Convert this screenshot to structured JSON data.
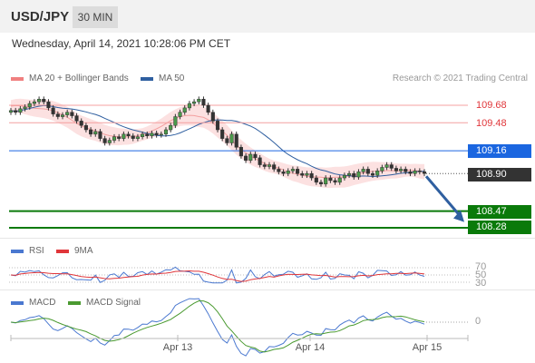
{
  "header": {
    "symbol": "USD/JPY",
    "timeframe": "30 MIN"
  },
  "datetime": "Wednesday, April 14, 2021 10:28:06 PM CET",
  "legend": {
    "items": [
      {
        "label": "MA 20 + Bollinger Bands",
        "color": "#f08080"
      },
      {
        "label": "MA 50",
        "color": "#2f5fa0"
      }
    ],
    "credit": "Research © 2021 Trading Central"
  },
  "chart_data": {
    "type": "candlestick",
    "symbol": "USD/JPY",
    "timeframe": "30 MIN",
    "x_ticks": [
      "Apr 13",
      "Apr 14",
      "Apr 15"
    ],
    "price_range": [
      108.2,
      109.85
    ],
    "closes": [
      109.62,
      109.6,
      109.64,
      109.66,
      109.7,
      109.72,
      109.75,
      109.72,
      109.65,
      109.58,
      109.55,
      109.57,
      109.6,
      109.56,
      109.5,
      109.45,
      109.4,
      109.35,
      109.38,
      109.3,
      109.25,
      109.28,
      109.32,
      109.3,
      109.35,
      109.33,
      109.3,
      109.32,
      109.35,
      109.33,
      109.36,
      109.34,
      109.35,
      109.4,
      109.45,
      109.55,
      109.6,
      109.65,
      109.7,
      109.72,
      109.75,
      109.68,
      109.6,
      109.5,
      109.4,
      109.3,
      109.25,
      109.35,
      109.2,
      109.1,
      109.05,
      109.12,
      109.08,
      109.0,
      108.98,
      109.0,
      108.95,
      108.92,
      108.9,
      108.93,
      108.95,
      108.9,
      108.88,
      108.9,
      108.85,
      108.8,
      108.78,
      108.85,
      108.82,
      108.8,
      108.85,
      108.88,
      108.9,
      108.86,
      108.92,
      108.95,
      108.9,
      108.88,
      108.93,
      108.97,
      109.0,
      108.96,
      108.93,
      108.95,
      108.92,
      108.9,
      108.93,
      108.92,
      108.9
    ],
    "levels": {
      "resistance": [
        109.68,
        109.48
      ],
      "pivot": 109.16,
      "last": 108.9,
      "targets": [
        108.47,
        108.28
      ]
    },
    "rsi": {
      "levels": [
        70,
        50,
        30
      ],
      "series": [
        "RSI",
        "9MA"
      ]
    },
    "macd": {
      "zero": 0,
      "series": [
        "MACD",
        "MACD Signal"
      ]
    }
  },
  "levels": {
    "r1": "109.68",
    "r2": "109.48",
    "pivot": "109.16",
    "last": "108.90",
    "t1": "108.47",
    "t2": "108.28"
  },
  "colors": {
    "resistance": "#e0363a",
    "pivot": "#1b66e0",
    "last": "#333333",
    "target": "#0a7a0a",
    "up": "#4a9a4a",
    "down": "#333333",
    "bb_fill": "#fce1e1",
    "ma50": "#2f5fa0",
    "arrow": "#2f5fa0"
  },
  "rsi_panel": {
    "legend": [
      {
        "label": "RSI",
        "color": "#4a78d0"
      },
      {
        "label": "9MA",
        "color": "#e0363a"
      }
    ],
    "levels": [
      "70",
      "50",
      "30"
    ]
  },
  "macd_panel": {
    "legend": [
      {
        "label": "MACD",
        "color": "#4a78d0"
      },
      {
        "label": "MACD Signal",
        "color": "#4a9a30"
      }
    ],
    "zero_label": "0"
  },
  "xaxis": {
    "labels": [
      "Apr 13",
      "Apr 14",
      "Apr 15"
    ]
  }
}
